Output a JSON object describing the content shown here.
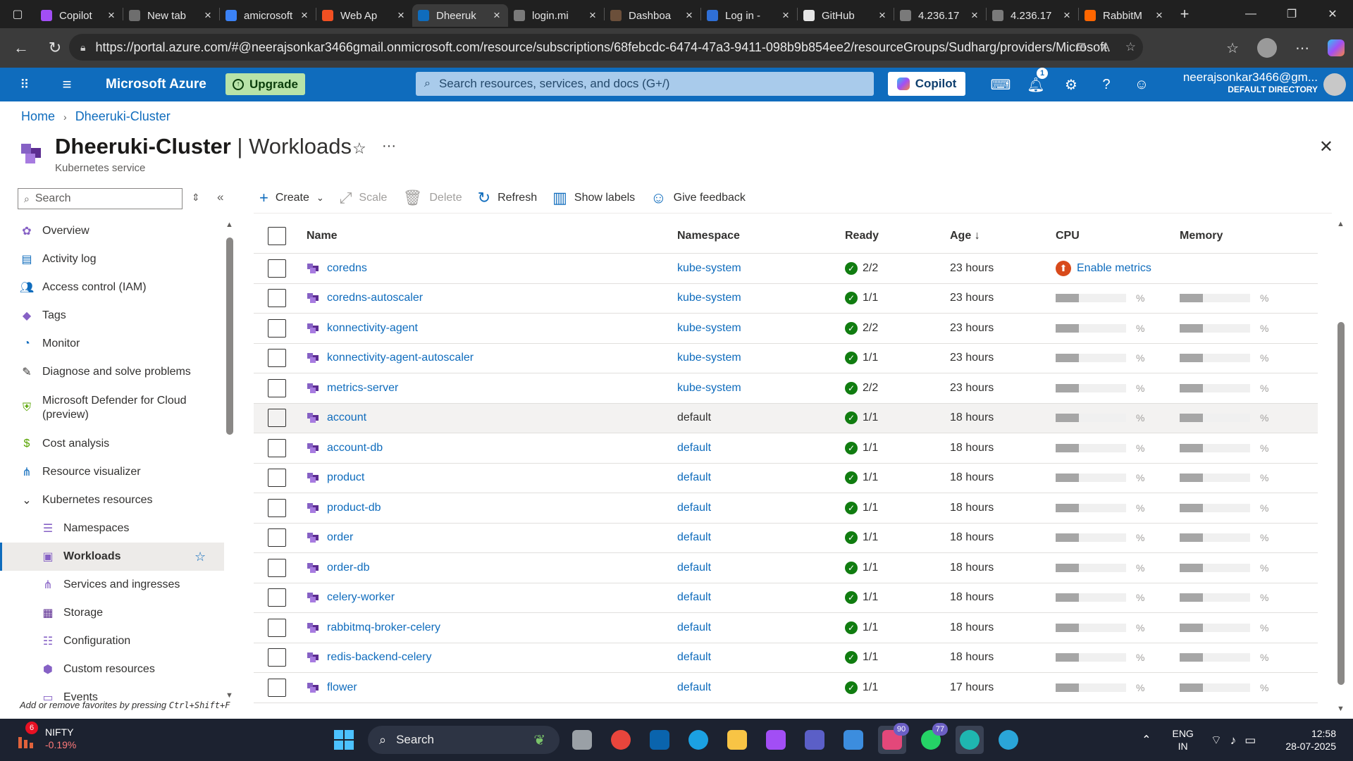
{
  "browser": {
    "tabs": [
      {
        "label": "Copilot",
        "color": "#a24ef5"
      },
      {
        "label": "New tab",
        "color": "#6e6e6e"
      },
      {
        "label": "amicrosoft",
        "color": "#3b82f6"
      },
      {
        "label": "Web Ap",
        "color": "#f25022"
      },
      {
        "label": "Dheeruk",
        "color": "#0f6cbd"
      },
      {
        "label": "login.mi",
        "color": "#7a7a7a"
      },
      {
        "label": "Dashboa",
        "color": "#6b4f3a"
      },
      {
        "label": "Log in -",
        "color": "#2f6fd6"
      },
      {
        "label": "GitHub",
        "color": "#e6e6e6"
      },
      {
        "label": "4.236.17",
        "color": "#7a7a7a"
      },
      {
        "label": "4.236.17",
        "color": "#7a7a7a"
      },
      {
        "label": "RabbitM",
        "color": "#f60"
      }
    ],
    "url": "https://portal.azure.com/#@neerajsonkar3466gmail.onmicrosoft.com/resource/subscriptions/68febcdc-6474-47a3-9411-098b9b854ee2/resourceGroups/Sudharg/providers/Microsoft.Con..."
  },
  "azure": {
    "brand": "Microsoft Azure",
    "upgrade_label": "Upgrade",
    "search_placeholder": "Search resources, services, and docs (G+/)",
    "copilot_label": "Copilot",
    "notification_count": "1",
    "user_email": "neerajsonkar3466@gm...",
    "user_directory": "DEFAULT DIRECTORY"
  },
  "breadcrumb": [
    "Home",
    "Dheeruki-Cluster"
  ],
  "page": {
    "title_resource": "Dheeruki-Cluster",
    "title_separator": " | ",
    "title_section": "Workloads",
    "subtitle": "Kubernetes service"
  },
  "leftnav": {
    "search_placeholder": "Search",
    "items": [
      {
        "label": "Overview",
        "icon": "overview-icon",
        "sub": false
      },
      {
        "label": "Activity log",
        "icon": "activity-log-icon",
        "sub": false
      },
      {
        "label": "Access control (IAM)",
        "icon": "iam-icon",
        "sub": false
      },
      {
        "label": "Tags",
        "icon": "tag-icon",
        "sub": false
      },
      {
        "label": "Monitor",
        "icon": "monitor-icon",
        "sub": false
      },
      {
        "label": "Diagnose and solve problems",
        "icon": "wrench-icon",
        "sub": false
      },
      {
        "label": "Microsoft Defender for Cloud (preview)",
        "icon": "shield-icon",
        "sub": false
      },
      {
        "label": "Cost analysis",
        "icon": "cost-icon",
        "sub": false
      },
      {
        "label": "Resource visualizer",
        "icon": "visualizer-icon",
        "sub": false
      },
      {
        "label": "Kubernetes resources",
        "icon": "chevron-down-icon",
        "sub": false
      },
      {
        "label": "Namespaces",
        "icon": "namespace-icon",
        "sub": true
      },
      {
        "label": "Workloads",
        "icon": "workload-icon",
        "sub": true,
        "active": true
      },
      {
        "label": "Services and ingresses",
        "icon": "services-icon",
        "sub": true
      },
      {
        "label": "Storage",
        "icon": "storage-icon",
        "sub": true
      },
      {
        "label": "Configuration",
        "icon": "configuration-icon",
        "sub": true
      },
      {
        "label": "Custom resources",
        "icon": "custom-resources-icon",
        "sub": true
      },
      {
        "label": "Events",
        "icon": "events-icon",
        "sub": true
      }
    ],
    "footer_text": "Add or remove favorites by pressing ",
    "footer_shortcut": "Ctrl+Shift+F"
  },
  "commands": {
    "create": "Create",
    "scale": "Scale",
    "delete": "Delete",
    "refresh": "Refresh",
    "show_labels": "Show labels",
    "feedback": "Give feedback"
  },
  "grid": {
    "columns": [
      "Name",
      "Namespace",
      "Ready",
      "Age",
      "CPU",
      "Memory"
    ],
    "age_sort_indicator": "↓",
    "enable_metrics_label": "Enable metrics",
    "rows": [
      {
        "name": "coredns",
        "namespace": "kube-system",
        "ready": "2/2",
        "age": "23 hours",
        "enable_metrics": true
      },
      {
        "name": "coredns-autoscaler",
        "namespace": "kube-system",
        "ready": "1/1",
        "age": "23 hours"
      },
      {
        "name": "konnectivity-agent",
        "namespace": "kube-system",
        "ready": "2/2",
        "age": "23 hours"
      },
      {
        "name": "konnectivity-agent-autoscaler",
        "namespace": "kube-system",
        "ready": "1/1",
        "age": "23 hours"
      },
      {
        "name": "metrics-server",
        "namespace": "kube-system",
        "ready": "2/2",
        "age": "23 hours"
      },
      {
        "name": "account",
        "namespace": "default",
        "ready": "1/1",
        "age": "18 hours",
        "highlighted": true
      },
      {
        "name": "account-db",
        "namespace": "default",
        "ready": "1/1",
        "age": "18 hours"
      },
      {
        "name": "product",
        "namespace": "default",
        "ready": "1/1",
        "age": "18 hours"
      },
      {
        "name": "product-db",
        "namespace": "default",
        "ready": "1/1",
        "age": "18 hours"
      },
      {
        "name": "order",
        "namespace": "default",
        "ready": "1/1",
        "age": "18 hours"
      },
      {
        "name": "order-db",
        "namespace": "default",
        "ready": "1/1",
        "age": "18 hours"
      },
      {
        "name": "celery-worker",
        "namespace": "default",
        "ready": "1/1",
        "age": "18 hours"
      },
      {
        "name": "rabbitmq-broker-celery",
        "namespace": "default",
        "ready": "1/1",
        "age": "18 hours"
      },
      {
        "name": "redis-backend-celery",
        "namespace": "default",
        "ready": "1/1",
        "age": "18 hours"
      },
      {
        "name": "flower",
        "namespace": "default",
        "ready": "1/1",
        "age": "17 hours"
      }
    ],
    "metric_fill_fraction": 0.33,
    "metric_unit": "%"
  },
  "taskbar": {
    "ticker_name": "NIFTY",
    "ticker_change": "-0.19%",
    "ticker_badge": "6",
    "search_label": "Search",
    "apps": [
      {
        "name": "file-explorer-icon",
        "color": "#9aa0a6"
      },
      {
        "name": "chrome-icon",
        "color": "#e8453c"
      },
      {
        "name": "outlook-icon",
        "color": "#0a64ad"
      },
      {
        "name": "edge-icon",
        "color": "#1ba1e2"
      },
      {
        "name": "folder-icon",
        "color": "#f8c445"
      },
      {
        "name": "copilot-icon",
        "color": "#a24ef5"
      },
      {
        "name": "teams-icon",
        "color": "#5b5fc7"
      },
      {
        "name": "network-icon",
        "color": "#3c8dde"
      },
      {
        "name": "store-icon",
        "color": "#e3487a",
        "badge": "90",
        "active": true
      },
      {
        "name": "whatsapp-icon",
        "color": "#25d366",
        "badge": "77"
      },
      {
        "name": "edge-dev-icon",
        "color": "#1fb6b0",
        "active": true
      },
      {
        "name": "edge-beta-icon",
        "color": "#2aa5d8"
      }
    ],
    "lang_top": "ENG",
    "lang_bottom": "IN",
    "time": "12:58",
    "date": "28-07-2025"
  }
}
